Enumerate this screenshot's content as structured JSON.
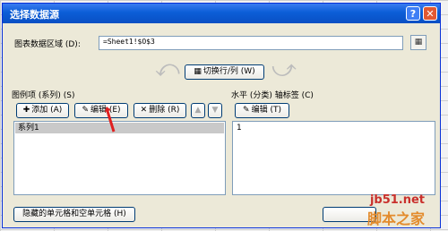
{
  "dialog": {
    "title": "选择数据源",
    "help": "?",
    "close": "✕"
  },
  "range": {
    "label": "图表数据区域 (D):",
    "value": "=Sheet1!$O$3"
  },
  "switch_button": "切换行/列 (W)",
  "legend": {
    "label": "图例项 (系列) (S)",
    "add": "添加 (A)",
    "edit": "编辑 (E)",
    "delete": "删除 (R)",
    "up": "▲",
    "down": "▼",
    "items": [
      "系列1"
    ]
  },
  "axis": {
    "label": "水平 (分类) 轴标签 (C)",
    "edit": "编辑 (T)",
    "items": [
      "1"
    ]
  },
  "hidden_cells_button": "隐藏的单元格和空单元格 (H)",
  "watermark": {
    "site": "jb51.net",
    "brand": "脚本之家"
  },
  "accent_colors": {
    "titlebar": "#0b5ed7",
    "highlight_arrow": "#e02020"
  }
}
